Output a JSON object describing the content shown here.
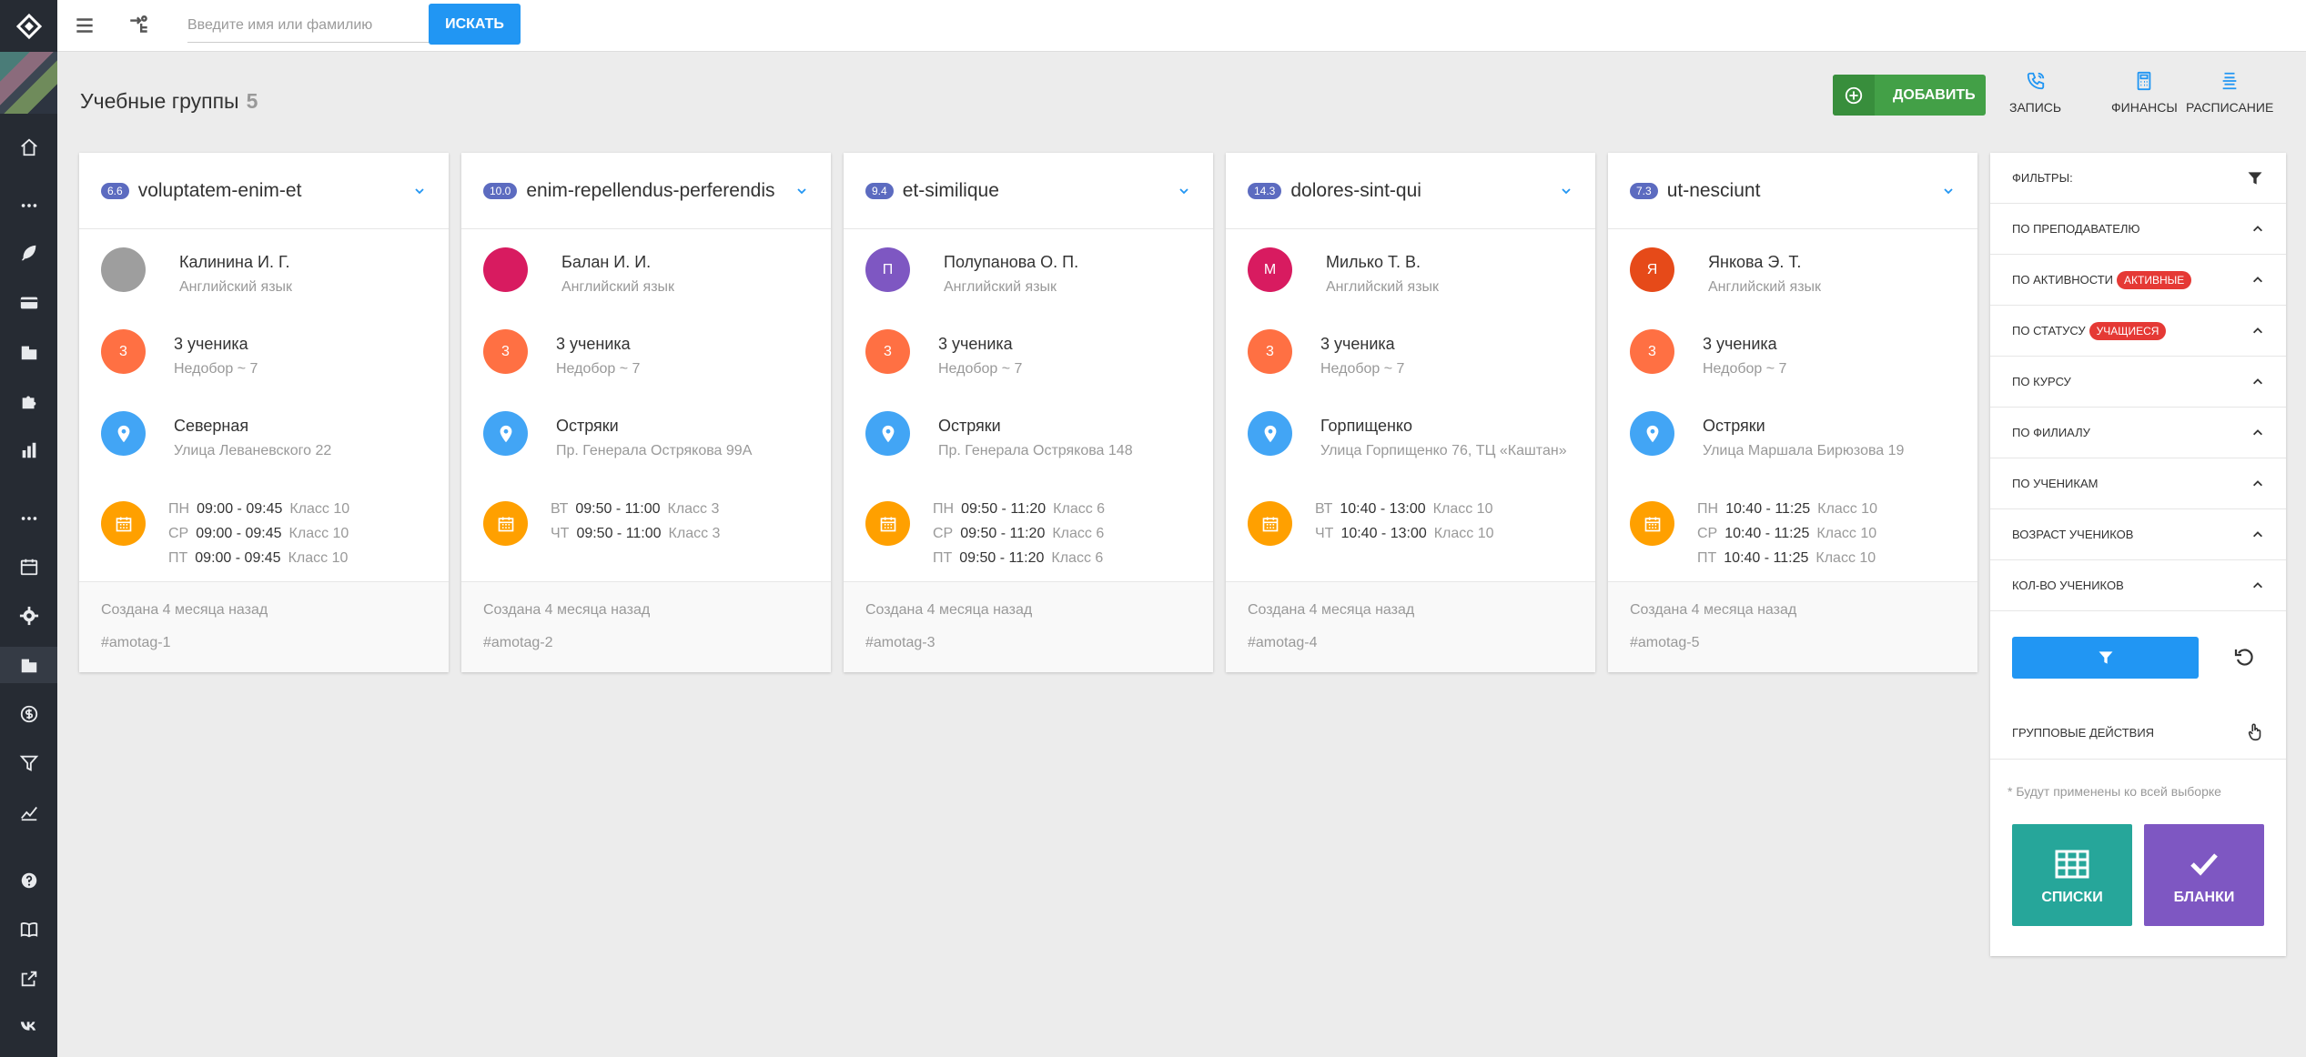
{
  "topbar": {
    "search_placeholder": "Введите имя или фамилию",
    "search_button": "ИСКАТЬ"
  },
  "page": {
    "title": "Учебные группы",
    "count": "5"
  },
  "actions": {
    "add": "ДОБАВИТЬ",
    "record": "ЗАПИСЬ",
    "finance": "ФИНАНСЫ",
    "schedule": "РАСПИСАНИЕ"
  },
  "groups": [
    {
      "rating": "6.6",
      "name": "voluptatem-enim-et",
      "teacher": "Калинина И. Г.",
      "teacher_initial": "",
      "avatar_color": "#9e9e9e",
      "subject": "Английский язык",
      "students_count": "3",
      "students": "3 ученика",
      "shortage": "Недобор ~ 7",
      "branch": "Северная",
      "address": "Улица Леваневского 22",
      "schedule": [
        {
          "day": "ПН",
          "time": "09:00 - 09:45",
          "room": "Класс 10"
        },
        {
          "day": "СР",
          "time": "09:00 - 09:45",
          "room": "Класс 10"
        },
        {
          "day": "ПТ",
          "time": "09:00 - 09:45",
          "room": "Класс 10"
        }
      ],
      "created": "Создана 4 месяца назад",
      "tag": "#amotag-1"
    },
    {
      "rating": "10.0",
      "name": "enim-repellendus-perferendis",
      "teacher": "Балан И. И.",
      "teacher_initial": "",
      "avatar_color": "#d81b60",
      "subject": "Английский язык",
      "students_count": "3",
      "students": "3 ученика",
      "shortage": "Недобор ~ 7",
      "branch": "Остряки",
      "address": "Пр. Генерала Острякова 99А",
      "schedule": [
        {
          "day": "ВТ",
          "time": "09:50 - 11:00",
          "room": "Класс 3"
        },
        {
          "day": "ЧТ",
          "time": "09:50 - 11:00",
          "room": "Класс 3"
        }
      ],
      "created": "Создана 4 месяца назад",
      "tag": "#amotag-2"
    },
    {
      "rating": "9.4",
      "name": "et-similique",
      "teacher": "Полупанова О. П.",
      "teacher_initial": "П",
      "avatar_color": "#7e57c2",
      "subject": "Английский язык",
      "students_count": "3",
      "students": "3 ученика",
      "shortage": "Недобор ~ 7",
      "branch": "Остряки",
      "address": "Пр. Генерала Острякова 148",
      "schedule": [
        {
          "day": "ПН",
          "time": "09:50 - 11:20",
          "room": "Класс 6"
        },
        {
          "day": "СР",
          "time": "09:50 - 11:20",
          "room": "Класс 6"
        },
        {
          "day": "ПТ",
          "time": "09:50 - 11:20",
          "room": "Класс 6"
        }
      ],
      "created": "Создана 4 месяца назад",
      "tag": "#amotag-3"
    },
    {
      "rating": "14.3",
      "name": "dolores-sint-qui",
      "teacher": "Милько Т. В.",
      "teacher_initial": "М",
      "avatar_color": "#d81b60",
      "subject": "Английский язык",
      "students_count": "3",
      "students": "3 ученика",
      "shortage": "Недобор ~ 7",
      "branch": "Горпищенко",
      "address": "Улица Горпищенко 76, ТЦ «Каштан»",
      "schedule": [
        {
          "day": "ВТ",
          "time": "10:40 - 13:00",
          "room": "Класс 10"
        },
        {
          "day": "ЧТ",
          "time": "10:40 - 13:00",
          "room": "Класс 10"
        }
      ],
      "created": "Создана 4 месяца назад",
      "tag": "#amotag-4"
    },
    {
      "rating": "7.3",
      "name": "ut-nesciunt",
      "teacher": "Янкова Э. Т.",
      "teacher_initial": "Я",
      "avatar_color": "#e64a19",
      "subject": "Английский язык",
      "students_count": "3",
      "students": "3 ученика",
      "shortage": "Недобор ~ 7",
      "branch": "Остряки",
      "address": "Улица Маршала Бирюзова 19",
      "schedule": [
        {
          "day": "ПН",
          "time": "10:40 - 11:25",
          "room": "Класс 10"
        },
        {
          "day": "СР",
          "time": "10:40 - 11:25",
          "room": "Класс 10"
        },
        {
          "day": "ПТ",
          "time": "10:40 - 11:25",
          "room": "Класс 10"
        }
      ],
      "created": "Создана 4 месяца назад",
      "tag": "#amotag-5"
    }
  ],
  "filters": {
    "title": "ФИЛЬТРЫ:",
    "items": [
      {
        "label": "ПО ПРЕПОДАВАТЕЛЮ",
        "pill": ""
      },
      {
        "label": "ПО АКТИВНОСТИ",
        "pill": "АКТИВНЫЕ"
      },
      {
        "label": "ПО СТАТУСУ",
        "pill": "УЧАЩИЕСЯ"
      },
      {
        "label": "ПО КУРСУ",
        "pill": ""
      },
      {
        "label": "ПО ФИЛИАЛУ",
        "pill": ""
      },
      {
        "label": "ПО УЧЕНИКАМ",
        "pill": ""
      },
      {
        "label": "ВОЗРАСТ УЧЕНИКОВ",
        "pill": ""
      },
      {
        "label": "КОЛ-ВО УЧЕНИКОВ",
        "pill": ""
      }
    ],
    "group_actions_title": "ГРУППОВЫЕ ДЕЙСТВИЯ",
    "group_actions_note": "* Будут применены ко всей выборке",
    "lists_button": "СПИСКИ",
    "blanks_button": "БЛАНКИ"
  },
  "colors": {
    "primary": "#2196f3",
    "add_green": "#43a047",
    "orange": "#ff7043",
    "amber": "#ffa000",
    "location_blue": "#42a5f5",
    "badge": "#5c6bc0",
    "pill_red": "#e53935",
    "lists_teal": "#26a69a",
    "blanks_purple": "#7e57c2",
    "rail": "#262b33"
  }
}
